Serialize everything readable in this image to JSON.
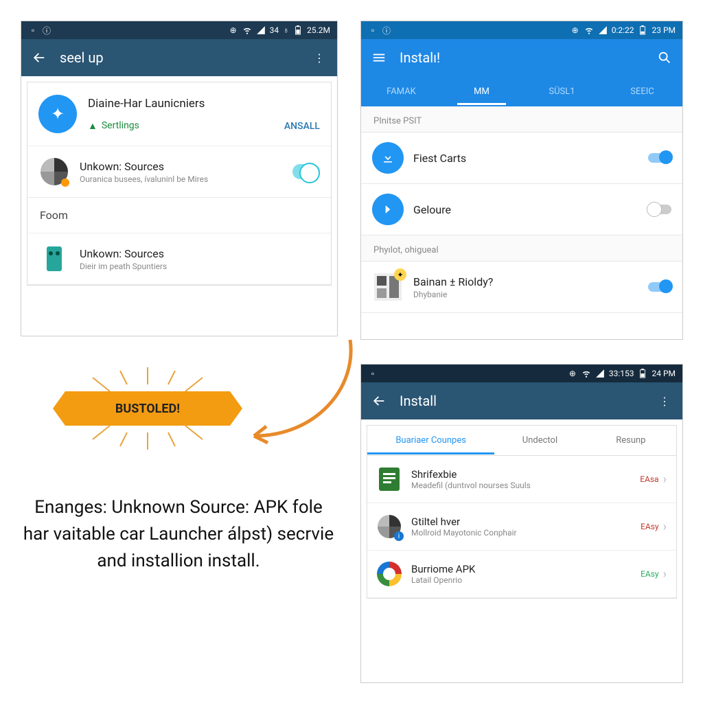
{
  "banner": "BUSTOLED!",
  "caption": "Enanges: Unknown Source: APK fole har vaitable car Launcher álpst) secrvie and installion install.",
  "screen1": {
    "status": {
      "signal": "34",
      "extra": "♁",
      "battery": "25.2M"
    },
    "appbar": {
      "title": "seel up"
    },
    "app": {
      "title": "Diaine-Har Launicniers",
      "settings": "Sertlings",
      "action": "ANSALL"
    },
    "row1": {
      "title": "Unkown: Sources",
      "sub": "Ouranica busees, ívaluninl be Mires"
    },
    "section": "Foom",
    "row2": {
      "title": "Unkown: Sources",
      "sub": "Dieir im peath Spuntiers"
    }
  },
  "screen2": {
    "status": {
      "time": "0:2:22",
      "battery": "23 PM"
    },
    "appbar": {
      "title": "Instalı!"
    },
    "tabs": [
      "FAMAK",
      "MM",
      "SÜSL1",
      "SEEIC"
    ],
    "section1": "PInitse PSIT",
    "row1": "Fiest Carts",
    "row2": "Geloure",
    "section2": "Phyılot, ohigueal",
    "row3": {
      "title": "Bainan ± Rioldy?",
      "sub": "Dhybanie"
    }
  },
  "screen3": {
    "status": {
      "time": "33:153",
      "battery": "24 PM"
    },
    "appbar": {
      "title": "Install"
    },
    "tabs": [
      "Buariaer Counpes",
      "Undectol",
      "Resunp"
    ],
    "rows": [
      {
        "title": "Shrifexbie",
        "sub": "Meadefil (duntıvol nourses Suuls",
        "badge": "EAsa",
        "color": "#c0392b"
      },
      {
        "title": "Gtiltel hver",
        "sub": "Mollroid Mayotonic Conphair",
        "badge": "EAsy",
        "color": "#c0392b"
      },
      {
        "title": "Burriome APK",
        "sub": "Latail Openrio",
        "badge": "EAsy",
        "color": "#27ae60"
      }
    ]
  }
}
